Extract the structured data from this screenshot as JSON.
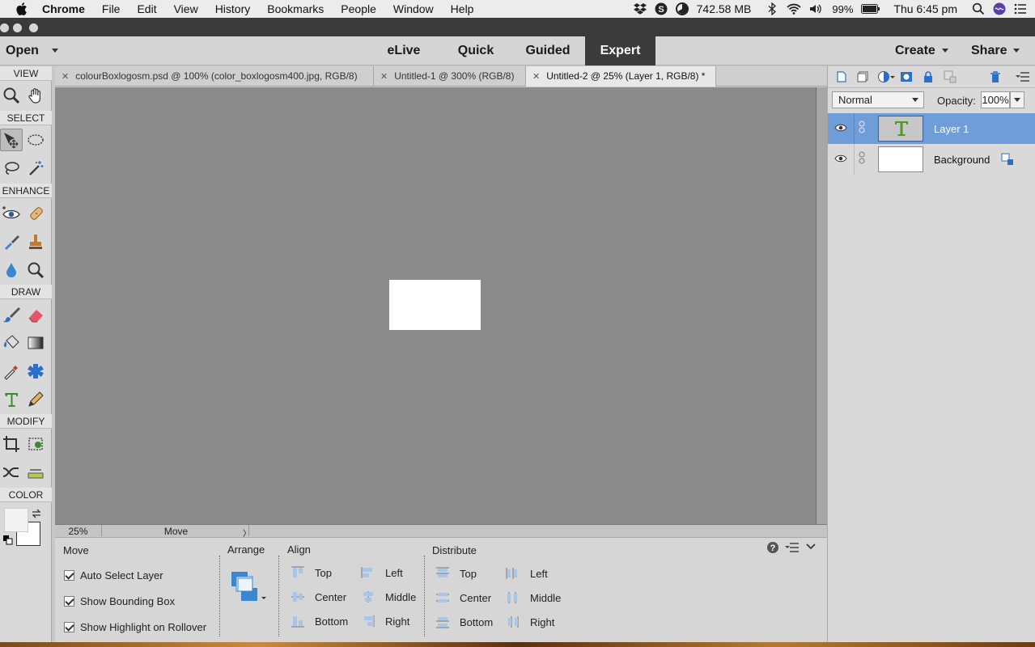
{
  "menubar": {
    "items": [
      "Chrome",
      "File",
      "Edit",
      "View",
      "History",
      "Bookmarks",
      "People",
      "Window",
      "Help"
    ],
    "memory": "742.58 MB",
    "battery": "99%",
    "clock": "Thu 6:45 pm"
  },
  "topbar": {
    "open_label": "Open",
    "modes": [
      "eLive",
      "Quick",
      "Guided",
      "Expert"
    ],
    "active_mode": "Expert",
    "create_label": "Create",
    "share_label": "Share"
  },
  "toolbox": {
    "sections": [
      "VIEW",
      "SELECT",
      "ENHANCE",
      "DRAW",
      "MODIFY",
      "COLOR"
    ],
    "tools": [
      "zoom-tool",
      "hand-tool",
      "move-tool",
      "marquee-tool",
      "lasso-tool",
      "magic-wand-tool",
      "red-eye-tool",
      "spot-healing-tool",
      "smart-brush-tool",
      "clone-stamp-tool",
      "blur-tool",
      "sponge-tool",
      "brush-tool",
      "eraser-tool",
      "paint-bucket-tool",
      "gradient-tool",
      "eyedropper-tool",
      "custom-shape-tool",
      "type-tool",
      "pencil-tool",
      "crop-tool",
      "recompose-tool",
      "content-aware-move-tool",
      "straighten-tool"
    ]
  },
  "doctabs": [
    {
      "label": "colourBoxlogosm.psd @ 100% (color_boxlogosm400.jpg, RGB/8)"
    },
    {
      "label": "Untitled-1 @ 300% (RGB/8)"
    },
    {
      "label": "Untitled-2 @ 25% (Layer 1, RGB/8) *"
    }
  ],
  "statusbar": {
    "zoom": "25%",
    "tool": "Move"
  },
  "options": {
    "title": "Move",
    "checkboxes": [
      "Auto Select Layer",
      "Show Bounding Box",
      "Show Highlight on Rollover"
    ],
    "arrange_label": "Arrange",
    "align_label": "Align",
    "align_items": [
      "Top",
      "Center",
      "Bottom",
      "Left",
      "Middle",
      "Right"
    ],
    "distribute_label": "Distribute",
    "distribute_items": [
      "Top",
      "Center",
      "Bottom",
      "Left",
      "Middle",
      "Right"
    ]
  },
  "layers": {
    "blend_mode": "Normal",
    "opacity_label": "Opacity:",
    "opacity": "100%",
    "items": [
      {
        "name": "Layer 1",
        "type": "text",
        "active": true
      },
      {
        "name": "Background",
        "type": "background",
        "active": false
      }
    ]
  },
  "colors": {
    "accent": "#6f9dd9",
    "active_mode_bg": "#3b3b3b",
    "canvas_bg": "#8b8b8b"
  }
}
